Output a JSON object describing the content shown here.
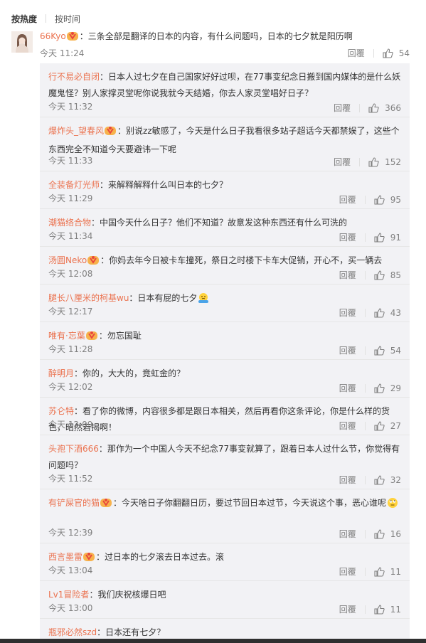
{
  "sort": {
    "hot": "按热度",
    "time": "按时间"
  },
  "main_comment": {
    "user": "66Kyo",
    "text": "：三条全部是翻译的日本的内容，有什么问题吗，日本的七夕就是阳历啊",
    "time": "今天 11:24",
    "reply_label": "回覆",
    "likes": "54"
  },
  "replies": [
    {
      "user": "行不易必自闭",
      "vip": false,
      "text": "：日本人过七夕在自己国家好好过呗，在77事变纪念日搬到国内媒体的是什么妖魔鬼怪？别人家撑灵堂呢你说我就今天结婚，你去人家灵堂唱好日子？",
      "time": "今天 11:32",
      "reply_label": "回覆",
      "likes": "366"
    },
    {
      "user": "爆炸头_望春风",
      "vip": true,
      "text": "：别说zz敏感了，今天是什么日子我看很多站子超话今天都禁娱了，这些个东西完全不知道今天要避讳一下呢",
      "time": "今天 11:33",
      "reply_label": "回覆",
      "likes": "152"
    },
    {
      "user": "全装备灯光师",
      "vip": false,
      "text": "：来解释解释什么叫日本的七夕？",
      "time": "今天 11:29",
      "reply_label": "回覆",
      "likes": "95"
    },
    {
      "user": "潮猫络合物",
      "vip": false,
      "text": "：中国今天什么日子？他们不知道？故意发这种东西还有什么可洗的",
      "time": "今天 11:34",
      "reply_label": "回覆",
      "likes": "91"
    },
    {
      "user": "汤圆Neko",
      "vip": true,
      "text": "：你妈去年今日被卡车撞死，祭日之时楼下卡车大促销，开心不，买一辆去",
      "time": "今天 12:08",
      "reply_label": "回覆",
      "likes": "85"
    },
    {
      "user": "腿长八厘米的柯基wu",
      "vip": false,
      "text": "：日本有屁的七夕",
      "emoji": "shrug-emoji",
      "time": "今天 12:17",
      "reply_label": "回覆",
      "likes": "43"
    },
    {
      "user": "唯有·忘葉",
      "vip": true,
      "text": "：勿忘国耻",
      "time": "今天 11:28",
      "reply_label": "回覆",
      "likes": "54"
    },
    {
      "user": "醉明月",
      "vip": false,
      "text": "：你的，大大的，竟虹金的？",
      "time": "今天 12:02",
      "reply_label": "回覆",
      "likes": "29"
    },
    {
      "user": "苏仑特",
      "vip": false,
      "text": "：看了你的微博，内容很多都是跟日本相关，然后再看你这条评论，你是什么样的货色，昭然若揭啊！",
      "time": "今天 12:09",
      "reply_label": "回覆",
      "likes": "27"
    },
    {
      "user": "头孢下酒666",
      "vip": false,
      "text": "：那作为一个中国人今天不纪念77事变就算了，跟着日本人过什么节，你觉得有问题吗？",
      "time": "今天 11:52",
      "reply_label": "回覆",
      "likes": "32"
    },
    {
      "user": "有铲屎官的猫",
      "vip": true,
      "text": "：今天啥日子你翻翻日历，要过节回日本过节，今天说这个事，恶心谁呢",
      "emoji": "eye-roll-emoji",
      "time": "今天 12:39",
      "reply_label": "回覆",
      "likes": "16"
    },
    {
      "user": "西言墨雷",
      "vip": true,
      "text": "：过日本的七夕滚去日本过去。滚",
      "time": "今天 13:04",
      "reply_label": "回覆",
      "likes": "11"
    },
    {
      "user": "Lv1冒险者",
      "vip": false,
      "text": "：我们庆祝核爆日吧",
      "time": "今天 13:00",
      "reply_label": "回覆",
      "likes": "11"
    },
    {
      "user": "瓶邪必然szd",
      "vip": false,
      "text": "：日本还有七夕？",
      "time": "",
      "reply_label": "",
      "likes": ""
    }
  ]
}
